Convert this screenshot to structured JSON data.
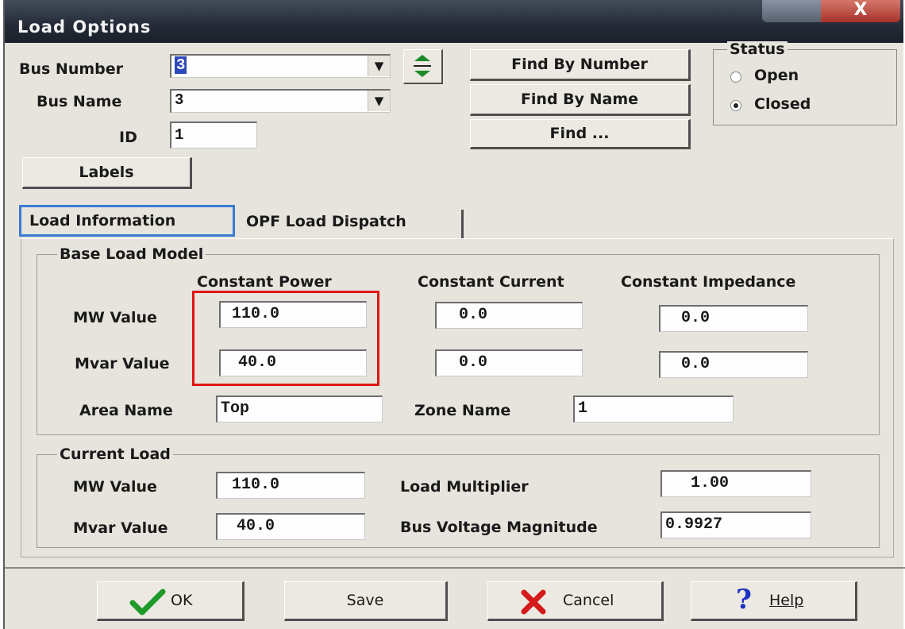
{
  "window": {
    "title": "Load Options",
    "close_glyph": "X"
  },
  "bus": {
    "number_label": "Bus Number",
    "number_value": "3",
    "name_label": "Bus Name",
    "name_value": "3",
    "id_label": "ID",
    "id_value": "1"
  },
  "buttons": {
    "find_by_number": "Find By Number",
    "find_by_name": "Find By Name",
    "find": "Find ...",
    "labels": "Labels"
  },
  "status": {
    "title": "Status",
    "options": [
      "Open",
      "Closed"
    ],
    "selected": "Closed"
  },
  "tabs": [
    {
      "label": "Load Information",
      "active": true
    },
    {
      "label": "OPF Load Dispatch",
      "active": false
    }
  ],
  "base_load_model": {
    "title": "Base Load Model",
    "columns": [
      "Constant Power",
      "Constant Current",
      "Constant Impedance"
    ],
    "rows": [
      {
        "label": "MW Value",
        "values": [
          "110.0",
          "0.0",
          "0.0"
        ]
      },
      {
        "label": "Mvar Value",
        "values": [
          "40.0",
          "0.0",
          "0.0"
        ]
      }
    ],
    "area_label": "Area Name",
    "area_value": "Top",
    "zone_label": "Zone Name",
    "zone_value": "1"
  },
  "current_load": {
    "title": "Current Load",
    "mw_label": "MW Value",
    "mw_value": "110.0",
    "mvar_label": "Mvar Value",
    "mvar_value": "40.0",
    "multiplier_label": "Load Multiplier",
    "multiplier_value": "1.00",
    "voltage_label": "Bus Voltage Magnitude",
    "voltage_value": "0.9927"
  },
  "footer": {
    "ok": "OK",
    "save": "Save",
    "cancel": "Cancel",
    "help": "Help"
  },
  "colors": {
    "highlight": "#e01515",
    "tab_focus": "#3a7bd5",
    "ok_icon": "#1f9a2a",
    "cancel_icon": "#d41a1a",
    "help_icon": "#1c2fc4"
  },
  "icons": {
    "ok": "checkmark-icon",
    "cancel": "x-icon",
    "help": "question-mark-icon",
    "spin": "spin-arrows-icon",
    "dropdown": "chevron-down-icon"
  }
}
